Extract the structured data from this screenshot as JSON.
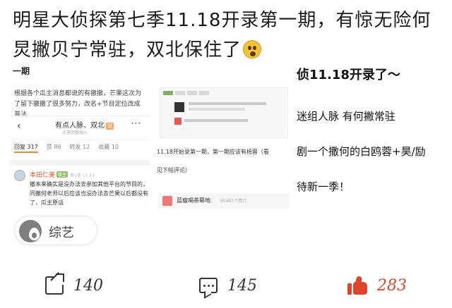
{
  "post": {
    "title": "明星大侦探第七季11.18开录第一期，有惊无险何炅撇贝宁常驻，双北保住了"
  },
  "panel1": {
    "heading": "一期",
    "paragraph": "根据各个瓜主消息都说的有撤撤，芒果这次为了留下撤撤了很多努力，改名+节目定位改成普法",
    "phone": {
      "back": "‹",
      "title": "有点人脉、双北",
      "tag": "冠",
      "subtitle": "点夹回复插入",
      "more": "···",
      "stats": [
        {
          "label": "回复 317"
        },
        {
          "label": "赞 86"
        },
        {
          "label": "转发 12"
        },
        {
          "label": "收藏 10"
        }
      ],
      "comment": {
        "user": "本田仁美",
        "badge": "楼主",
        "meta": "第5楼 11:43",
        "text": "撤本来确实是没办法去参加其他平台的节目的，同撤何老师以后应该也没办法去芒果以后都没有了，瓜主原话"
      }
    },
    "chip": {
      "icon": "flame-icon",
      "label": "综艺"
    }
  },
  "panel2": {
    "line1": "11.18开始录第一期，第一期应该有杨蓉（看",
    "line2": "见下帖评论）",
    "footer": {
      "name": "蓝瘦喝茶幕地",
      "sub": "95487个赞几"
    }
  },
  "panel3": {
    "headline": "侦11.18开录了～",
    "row2": "迷组人脉 有何撇常驻",
    "row3": "剧一个撒何的白鸥蓉+昊/励",
    "row4": "待新一季！"
  },
  "actions": {
    "share": {
      "icon": "share-icon",
      "count": "140"
    },
    "comment": {
      "icon": "comment-icon",
      "count": "145"
    },
    "like": {
      "icon": "thumbs-up-icon",
      "count": "283",
      "color": "#e0452c"
    }
  }
}
